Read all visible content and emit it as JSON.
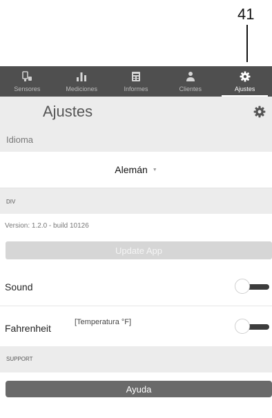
{
  "callout": {
    "number": "41"
  },
  "tabs": [
    {
      "label": "Sensores",
      "icon": "sensor-icon"
    },
    {
      "label": "Mediciones",
      "icon": "bar-chart-icon"
    },
    {
      "label": "Informes",
      "icon": "report-icon"
    },
    {
      "label": "Clientes",
      "icon": "clients-icon"
    },
    {
      "label": "Ajustes",
      "icon": "gear-icon",
      "active": true
    }
  ],
  "header": {
    "title": "Ajustes",
    "icon": "gear-icon"
  },
  "language": {
    "section_label": "Idioma",
    "selected": "Alemán"
  },
  "div_section": {
    "label": "DIV",
    "version": "Version: 1.2.0 - build 10126",
    "update_button": "Update App"
  },
  "sound": {
    "label": "Sound",
    "enabled": false
  },
  "fahrenheit": {
    "label": "Fahrenheit",
    "description": "[Temperatura °F]",
    "enabled": false
  },
  "support": {
    "label": "SUPPORT",
    "help_button": "Ayuda"
  },
  "colors": {
    "tabbar": "#4f4f4f",
    "section_bg": "#ececec",
    "help_button": "#6a6a6a",
    "update_button": "#d6d6d6"
  }
}
